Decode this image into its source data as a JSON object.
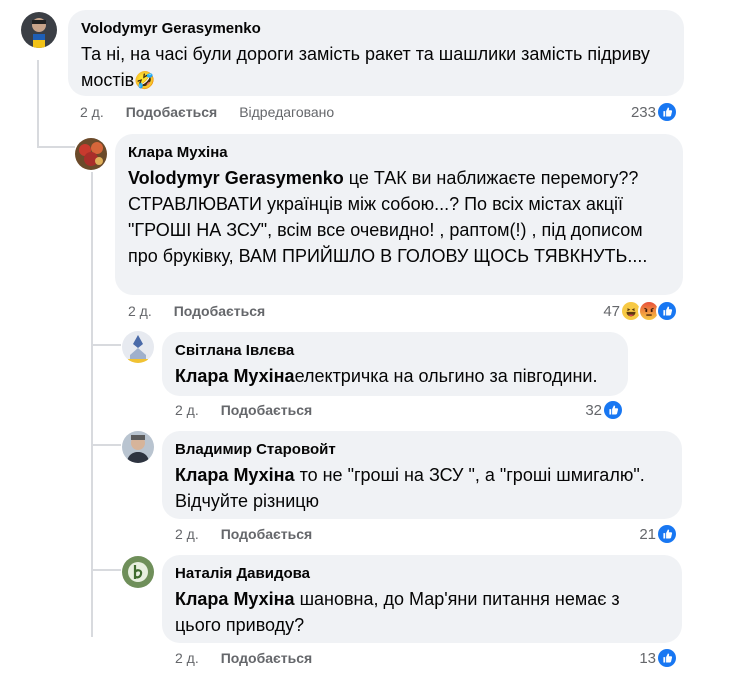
{
  "comments": [
    {
      "author": "Volodymyr Gerasymenko",
      "text": "Та ні, на часі були дороги замість ракет та шашлики замість підриву мостів",
      "emoji": "🤣",
      "time": "2 д.",
      "like_label": "Подобається",
      "edited_label": "Відредаговано",
      "reaction_count": "233",
      "reaction_icons": [
        "like-icon"
      ]
    },
    {
      "author": "Клара Мухіна",
      "mention": "Volodymyr Gerasymenko",
      "text": " це ТАК ви наближаєте перемогу?? СТРАВЛЮВАТИ українців між собою...? По всіх містах акції \"ГРОШІ НА ЗСУ\", всім все очевидно! , раптом(!) , під дописом про бруківку, ВАМ ПРИЙШЛО В ГОЛОВУ ЩОСЬ ТЯВКНУТЬ....",
      "time": "2 д.",
      "like_label": "Подобається",
      "reaction_count": "47",
      "reaction_icons": [
        "haha-icon",
        "angry-icon",
        "like-icon"
      ]
    },
    {
      "author": "Світлана Івлєва",
      "mention": "Клара Мухіна",
      "text": "електричка на ольгино за півгодини.",
      "time": "2 д.",
      "like_label": "Подобається",
      "reaction_count": "32",
      "reaction_icons": [
        "like-icon"
      ]
    },
    {
      "author": "Владимир Старовойт",
      "mention": "Клара Мухіна",
      "text": " то не \"гроші на ЗСУ \", а \"гроші шмигалю\". Відчуйте різницю",
      "time": "2 д.",
      "like_label": "Подобається",
      "reaction_count": "21",
      "reaction_icons": [
        "like-icon"
      ]
    },
    {
      "author": "Наталія Давидова",
      "mention": "Клара Мухіна",
      "text": " шановна, до Мар'яни питання немає з цього приводу?",
      "time": "2 д.",
      "like_label": "Подобається",
      "reaction_count": "13",
      "reaction_icons": [
        "like-icon"
      ]
    }
  ],
  "colors": {
    "bubble": "#f0f2f5",
    "like_blue": "#1877f2",
    "meta_gray": "#65676b",
    "thread_line": "#d8dade"
  }
}
